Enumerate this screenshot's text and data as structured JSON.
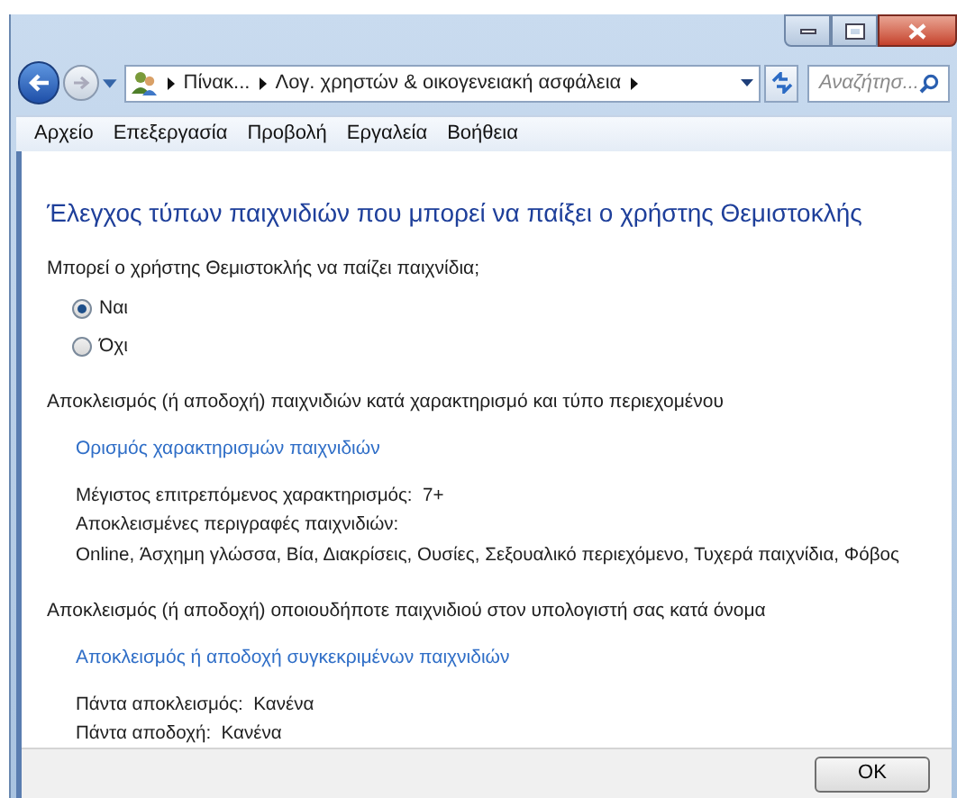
{
  "address_bar": {
    "crumbs": [
      "Πίνακ...",
      "Λογ. χρηστών & οικογενειακή ασφάλεια"
    ],
    "search_placeholder": "Αναζήτησ..."
  },
  "menu": [
    "Αρχείο",
    "Επεξεργασία",
    "Προβολή",
    "Εργαλεία",
    "Βοήθεια"
  ],
  "heading": "Έλεγχος τύπων παιχνιδιών που μπορεί να παίξει ο χρήστης Θεμιστοκλής",
  "question": "Μπορεί ο χρήστης Θεμιστοκλής να παίζει παιχνίδια;",
  "options": [
    {
      "label": "Ναι",
      "selected": true
    },
    {
      "label": "Όχι",
      "selected": false
    }
  ],
  "sections": [
    {
      "title": "Αποκλεισμός (ή αποδοχή) παιχνιδιών κατά χαρακτηρισμό και τύπο περιεχομένου",
      "link": "Ορισμός χαρακτηρισμών παιχνιδιών",
      "lines": [
        "Μέγιστος επιτρεπόμενος χαρακτηρισμός:  7+",
        "Αποκλεισμένες περιγραφές παιχνιδιών:",
        "Online, Άσχημη γλώσσα, Βία, Διακρίσεις, Ουσίες, Σεξουαλικό περιεχόμενο, Τυχερά παιχνίδια, Φόβος"
      ]
    },
    {
      "title": "Αποκλεισμός (ή αποδοχή) οποιουδήποτε παιχνιδιού στον υπολογιστή σας κατά όνομα",
      "link": "Αποκλεισμός ή αποδοχή συγκεκριμένων παιχνιδιών",
      "lines": [
        "Πάντα αποκλεισμός:  Κανένα",
        "Πάντα αποδοχή:  Κανένα"
      ]
    }
  ],
  "ok_button": "OK"
}
